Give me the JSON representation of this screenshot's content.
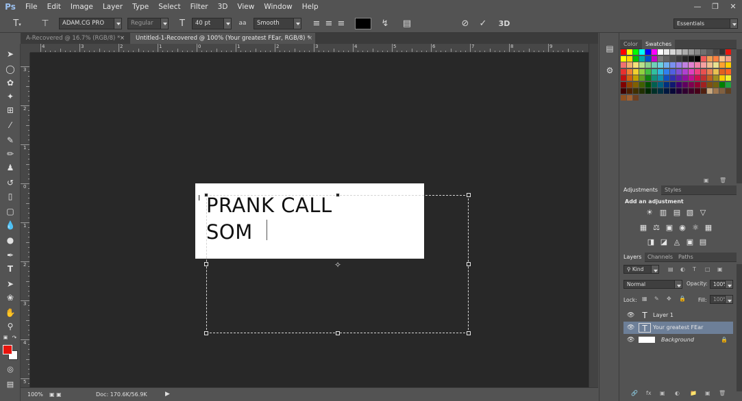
{
  "menubar": {
    "logo": "Ps",
    "items": [
      "File",
      "Edit",
      "Image",
      "Layer",
      "Type",
      "Select",
      "Filter",
      "3D",
      "View",
      "Window",
      "Help"
    ]
  },
  "options": {
    "font_family": "ADAM.CG PRO",
    "font_style": "Regular",
    "font_size": "40 pt",
    "aa_icon_label": "a",
    "anti_alias": "Smooth",
    "text_color": "#000000",
    "three_d": "3D",
    "workspace": "Essentials"
  },
  "tabs": [
    {
      "label": "A-Recovered @ 16.7% (RGB/8) *",
      "active": false
    },
    {
      "label": "Untitled-1-Recovered @ 100% (Your greatest  FEar, RGB/8) *",
      "active": true
    }
  ],
  "rulers": {
    "h_labels": [
      "4",
      "3",
      "2",
      "1",
      "0",
      "1",
      "2",
      "3",
      "4",
      "5",
      "6",
      "7",
      "8",
      "9"
    ],
    "v_labels": [
      "3",
      "2",
      "1",
      "0",
      "1",
      "2",
      "3",
      "4",
      "5"
    ]
  },
  "document": {
    "line1": "PRANK CALL",
    "line2": "SOM"
  },
  "status": {
    "zoom": "100%",
    "doc": "Doc: 170.6K/56.9K"
  },
  "swatches_panel": {
    "tabs": [
      "Color",
      "Swatches"
    ],
    "active": "Swatches"
  },
  "adjustments_panel": {
    "tabs": [
      "Adjustments",
      "Styles"
    ],
    "title": "Add an adjustment"
  },
  "layers_panel": {
    "tabs": [
      "Layers",
      "Channels",
      "Paths"
    ],
    "kind": "Kind",
    "blend_mode": "Normal",
    "opacity_label": "Opacity:",
    "opacity": "100%",
    "lock_label": "Lock:",
    "fill_label": "Fill:",
    "fill": "100%",
    "layers": [
      {
        "name": "Layer 1",
        "type": "text",
        "selected": false
      },
      {
        "name": "Your greatest  FEar",
        "type": "text",
        "selected": true
      },
      {
        "name": "Background",
        "type": "image",
        "selected": false
      }
    ]
  },
  "colors": {
    "foreground": "#e8140c",
    "background": "#ffffff",
    "accent_selected": "#6d7f98"
  }
}
